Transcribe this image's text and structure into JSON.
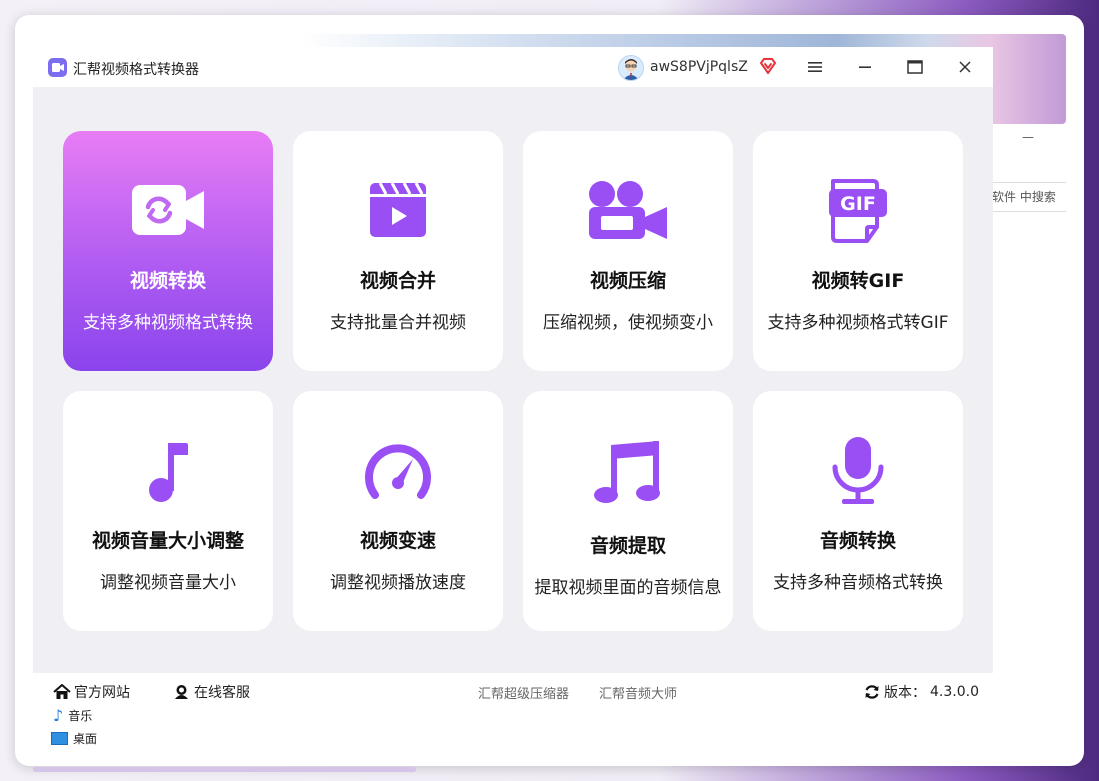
{
  "window": {
    "title": "汇帮视频格式转换器"
  },
  "user": {
    "name": "awS8PVjPqlsZ"
  },
  "colors": {
    "accent": "#8a44ec",
    "icon": "#9a4ff5",
    "active_gradient_top": "#e87df5"
  },
  "features": [
    {
      "title": "视频转换",
      "desc": "支持多种视频格式转换",
      "icon": "video-convert-icon",
      "active": true
    },
    {
      "title": "视频合并",
      "desc": "支持批量合并视频",
      "icon": "clapperboard-icon"
    },
    {
      "title": "视频压缩",
      "desc": "压缩视频，使视频变小",
      "icon": "video-camera-icon"
    },
    {
      "title": "视频转GIF",
      "desc": "支持多种视频格式转GIF",
      "icon": "gif-file-icon"
    },
    {
      "title": "视频音量大小调整",
      "desc": "调整视频音量大小",
      "icon": "music-note-icon"
    },
    {
      "title": "视频变速",
      "desc": "调整视频播放速度",
      "icon": "speedometer-icon"
    },
    {
      "title": "音频提取",
      "desc": "提取视频里面的音频信息",
      "icon": "music-notes-icon"
    },
    {
      "title": "音频转换",
      "desc": "支持多种音频格式转换",
      "icon": "microphone-icon"
    }
  ],
  "footer": {
    "website": "官方网站",
    "support": "在线客服",
    "links": [
      "汇帮超级压缩器",
      "汇帮音频大师"
    ],
    "version_label": "版本：",
    "version": "4.3.0.0"
  },
  "background": {
    "right_search": "软件 中搜索",
    "right_dash": "—",
    "side_items": [
      "音乐",
      "桌面"
    ]
  }
}
